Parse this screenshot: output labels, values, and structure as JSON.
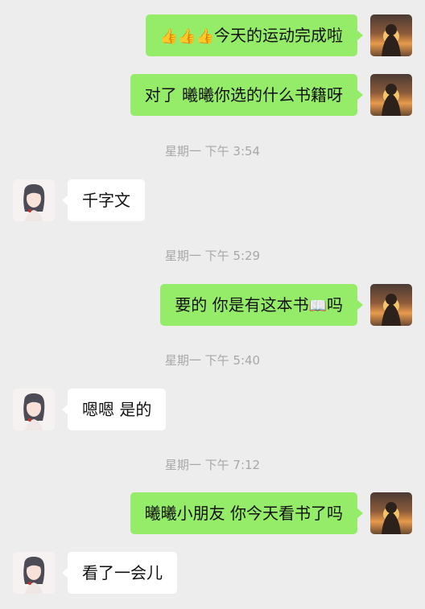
{
  "messages": [
    {
      "type": "sent",
      "prefix_icons": [
        "thumbs-up",
        "thumbs-up",
        "thumbs-up"
      ],
      "text": "今天的运动完成啦"
    },
    {
      "type": "sent",
      "text": "对了 曦曦你选的什么书籍呀"
    },
    {
      "type": "time",
      "text": "星期一 下午 3:54"
    },
    {
      "type": "received",
      "text": "千字文"
    },
    {
      "type": "time",
      "text": "星期一 下午 5:29"
    },
    {
      "type": "sent",
      "text": "要的 你是有这本书",
      "suffix_icon": "book",
      "text_after": "吗"
    },
    {
      "type": "time",
      "text": "星期一 下午 5:40"
    },
    {
      "type": "received",
      "text": "嗯嗯  是的"
    },
    {
      "type": "time",
      "text": "星期一 下午 7:12"
    },
    {
      "type": "sent",
      "text": "曦曦小朋友 你今天看书了吗"
    },
    {
      "type": "received",
      "text": "看了一会儿"
    }
  ]
}
